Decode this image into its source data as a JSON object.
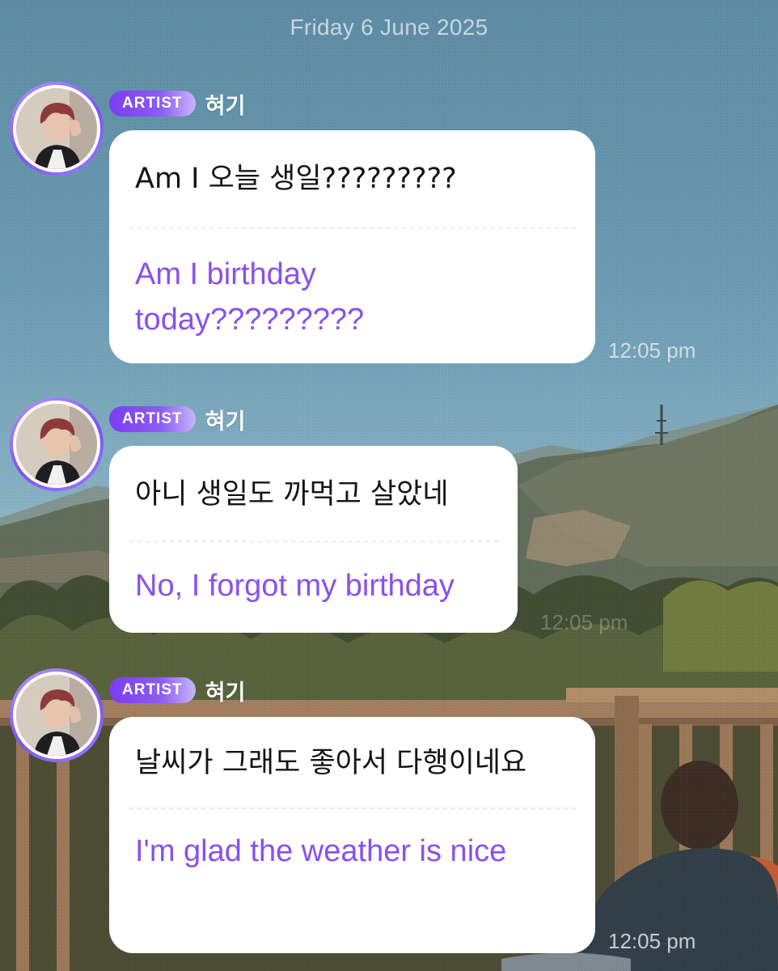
{
  "chat": {
    "date_divider": "Friday 6 June 2025",
    "messages": [
      {
        "badge": "ARTIST",
        "sender": "혀기",
        "original": "Am I 오늘 생일?????????",
        "translation": "Am I birthday today?????????",
        "time": "12:05 pm"
      },
      {
        "badge": "ARTIST",
        "sender": "혀기",
        "original": "아니 생일도 까먹고 살았네",
        "translation": "No, I forgot my birthday",
        "time": "12:05 pm"
      },
      {
        "badge": "ARTIST",
        "sender": "혀기",
        "original": "날씨가 그래도 좋아서 다행이네요",
        "translation": "I'm glad the weather is nice",
        "time": "12:05 pm"
      }
    ]
  },
  "colors": {
    "accent": "#8b50ec",
    "badge": "#7a3df0",
    "bubble": "#ffffff"
  }
}
